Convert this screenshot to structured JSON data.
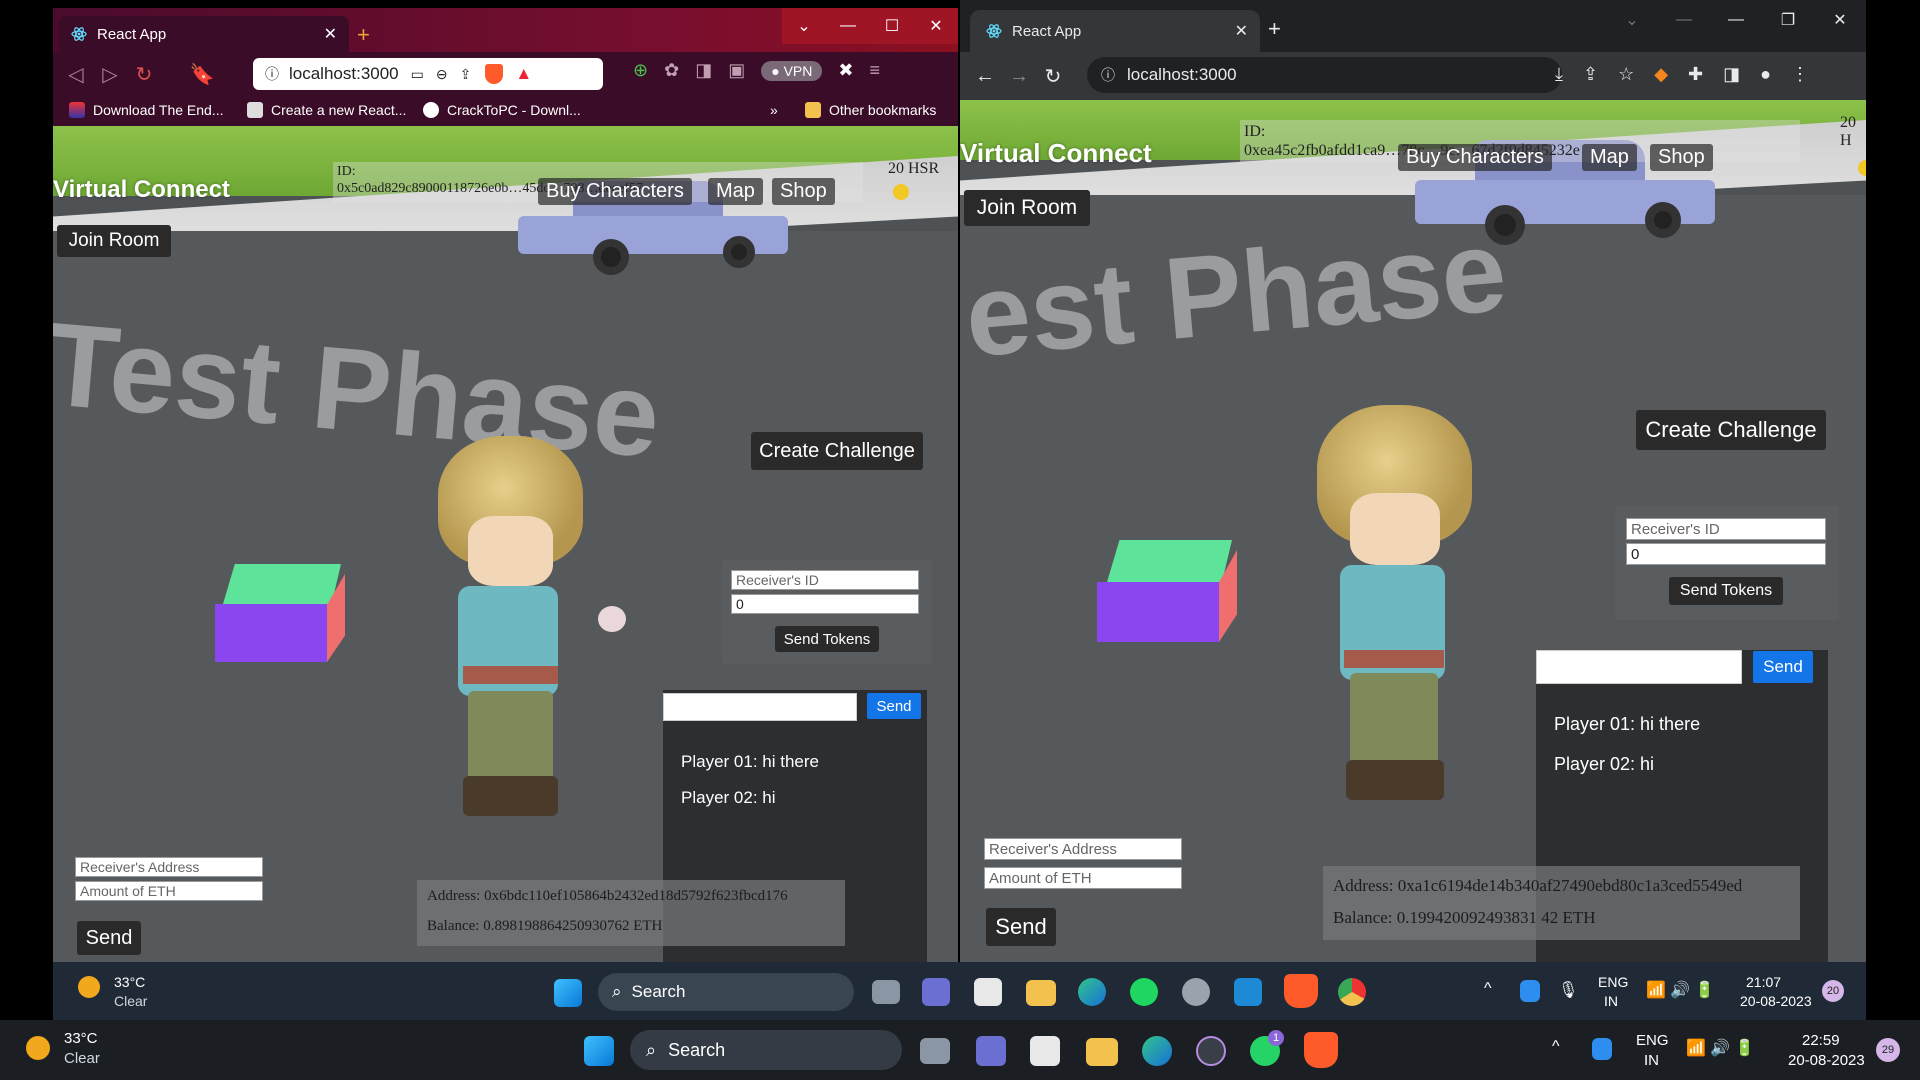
{
  "left_browser": {
    "tab_title": "React App",
    "url": "localhost:3000",
    "vpn_label": "VPN",
    "bookmarks": [
      "Download The End...",
      "Create a new React...",
      "CrackToPC - Downl..."
    ],
    "more_bookmarks": "»",
    "other_bookmarks": "Other bookmarks"
  },
  "right_browser": {
    "tab_title": "React App",
    "url": "localhost:3000"
  },
  "left_game": {
    "title": "Virtual Connect",
    "id_label": "ID:",
    "id_value": "0x5c0ad829c89000118726e0b…45dc…798…deeef57",
    "hsr": "20 HSR",
    "menu": [
      "Buy Characters",
      "Map",
      "Shop"
    ],
    "join_room": "Join Room",
    "watermark": "Test Phase",
    "create_challenge": "Create Challenge",
    "receiver_id_placeholder": "Receiver's ID",
    "amount_value": "0",
    "send_tokens": "Send Tokens",
    "chat_send": "Send",
    "messages": [
      "Player 01: hi there",
      "Player 02: hi"
    ],
    "receiver_address_placeholder": "Receiver's Address",
    "amount_eth_placeholder": "Amount of ETH",
    "send": "Send",
    "address": "Address: 0x6bdc110ef105864b2432ed18d5792f623fbcd176",
    "balance": "Balance: 0.898198864250930762 ETH"
  },
  "right_game": {
    "title": "Virtual Connect",
    "id_label": "ID:",
    "id_value": "0xea45c2fb0afdd1ca9…78c…9e…67d2f9d845232e",
    "hsr": "20 H",
    "menu": [
      "Buy Characters",
      "Map",
      "Shop"
    ],
    "join_room": "Join Room",
    "watermark": "est Phase",
    "create_challenge": "Create Challenge",
    "receiver_id_placeholder": "Receiver's ID",
    "amount_value": "0",
    "send_tokens": "Send Tokens",
    "chat_send": "Send",
    "messages": [
      "Player 01: hi there",
      "Player 02: hi"
    ],
    "receiver_address_placeholder": "Receiver's Address",
    "amount_eth_placeholder": "Amount of ETH",
    "send": "Send",
    "address": "Address: 0xa1c6194de14b340af27490ebd80c1a3ced5549ed",
    "balance": "Balance: 0.199420092493831 42 ETH"
  },
  "inner_taskbar": {
    "temp": "33°C",
    "weather": "Clear",
    "search": "Search",
    "lang1": "ENG",
    "lang2": "IN",
    "time": "21:07",
    "date": "20-08-2023",
    "badge": "20"
  },
  "outer_taskbar": {
    "temp": "33°C",
    "weather": "Clear",
    "search": "Search",
    "lang1": "ENG",
    "lang2": "IN",
    "time": "22:59",
    "date": "20-08-2023",
    "badge": "29",
    "whatsapp_badge": "1"
  },
  "colors": {
    "brave_frame": "#3c0a2a",
    "chrome_frame": "#202124",
    "accent_blue": "#1475e8",
    "cube_top": "#5ee39a",
    "cube_front": "#8a46ef",
    "cube_side": "#ef6e6e"
  }
}
